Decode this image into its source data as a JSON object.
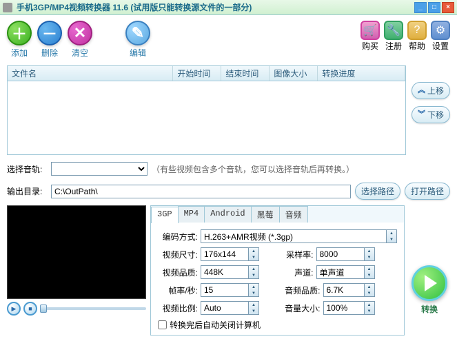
{
  "window": {
    "title": "手机3GP/MP4视频转换器 11.6 (试用版只能转换源文件的一部分)"
  },
  "toolbar": {
    "add": "添加",
    "del": "删除",
    "clr": "清空",
    "edit": "编辑",
    "buy": "购买",
    "reg": "注册",
    "help": "帮助",
    "set": "设置"
  },
  "table": {
    "cols": [
      "文件名",
      "开始时间",
      "结束时间",
      "图像大小",
      "转换进度"
    ]
  },
  "side": {
    "up": "上移",
    "down": "下移"
  },
  "track": {
    "label": "选择音轨:",
    "hint": "（有些视频包含多个音轨，您可以选择音轨后再转换。）"
  },
  "output": {
    "label": "输出目录:",
    "value": "C:\\OutPath\\",
    "choose": "选择路径",
    "open": "打开路径"
  },
  "tabs": [
    "3GP",
    "MP4",
    "Android",
    "黑莓",
    "音频"
  ],
  "form": {
    "codec_label": "编码方式:",
    "codec_value": "H.263+AMR视频 (*.3gp)",
    "size_label": "视频尺寸:",
    "size_value": "176x144",
    "rate_label": "采样率:",
    "rate_value": "8000",
    "vq_label": "视频品质:",
    "vq_value": "448K",
    "chan_label": "声道:",
    "chan_value": "单声道",
    "fps_label": "帧率/秒:",
    "fps_value": "15",
    "aq_label": "音频品质:",
    "aq_value": "6.7K",
    "ratio_label": "视频比例:",
    "ratio_value": "Auto",
    "vol_label": "音量大小:",
    "vol_value": "100%",
    "shutdown": "转换完后自动关闭计算机"
  },
  "convert": "转换"
}
